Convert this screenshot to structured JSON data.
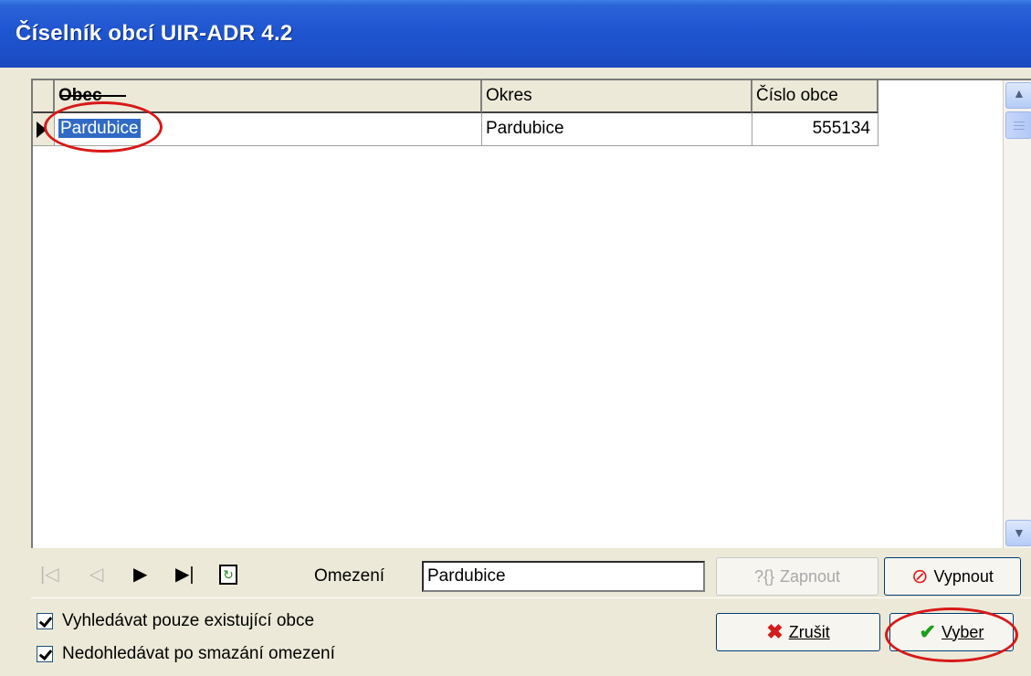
{
  "window": {
    "title": "Číselník obcí UIR-ADR 4.2"
  },
  "grid": {
    "columns": [
      "Obec",
      "Okres",
      "Číslo obce"
    ],
    "rows": [
      {
        "obec": "Pardubice",
        "okres": "Pardubice",
        "cislo": "555134"
      }
    ]
  },
  "toolbar": {
    "omezeni_label": "Omezení",
    "omezeni_value": "Pardubice",
    "zapnout_label": "Zapnout",
    "zapnout_icon_text": "?{}",
    "vypnout_label": "Vypnout"
  },
  "options": {
    "check1_label": "Vyhledávat pouze existující obce",
    "check1_checked": true,
    "check2_label": "Nedohledávat po smazání omezení",
    "check2_checked": true
  },
  "actions": {
    "zrusit_label": "Zrušit",
    "vyber_label": "Vyber"
  },
  "colors": {
    "titlebar": "#1f55d0",
    "selection": "#316ac5",
    "annotation": "#d81818"
  },
  "icons": {
    "cancel": "red-x-icon",
    "confirm": "green-check-icon",
    "disable": "red-no-icon"
  }
}
